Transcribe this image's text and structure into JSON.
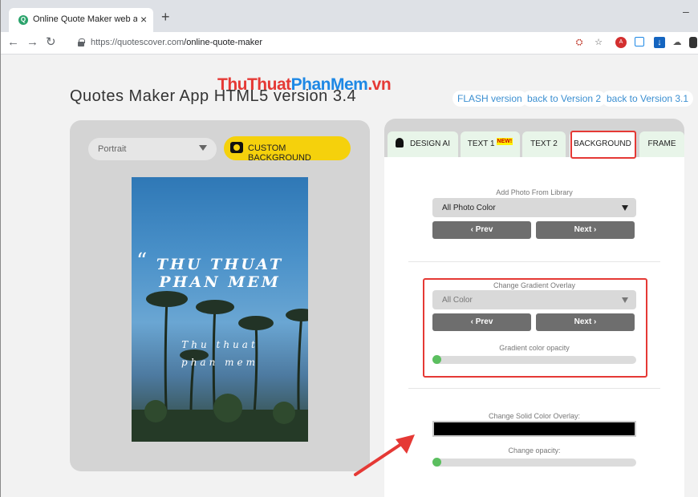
{
  "browser": {
    "tab_title": "Online Quote Maker web applica",
    "tab_favicon": "Q",
    "url_host": "https://quotescover.com",
    "url_path": "/online-quote-maker"
  },
  "page": {
    "title": "Quotes Maker App HTML5 version 3.4",
    "version_links": [
      "FLASH version",
      "back to Version 2",
      "back to Version 3.1"
    ],
    "orientation_select": "Portrait",
    "custom_background_label": "CUSTOM BACKGROUND",
    "watermark_part1": "ThuThuat",
    "watermark_part2": "PhanMem",
    "watermark_part3": ".vn",
    "quote_main_line1": "THU THUAT",
    "quote_main_line2": "PHAN MEM",
    "quote_author_line1": "Thu thuat",
    "quote_author_line2": "phan mem"
  },
  "tabs": {
    "design_ai": "DESIGN AI",
    "text1": "TEXT 1",
    "text1_badge": "NEW!",
    "text2": "TEXT 2",
    "background": "BACKGROUND",
    "frame": "FRAME"
  },
  "library": {
    "label": "Add Photo From Library",
    "select_value": "All Photo Color",
    "prev": "‹ Prev",
    "next": "Next ›"
  },
  "gradient": {
    "label": "Change Gradient Overlay",
    "select_value": "All Color",
    "prev": "‹ Prev",
    "next": "Next ›",
    "opacity_label": "Gradient color opacity",
    "opacity_value": 0
  },
  "solid": {
    "label": "Change Solid Color Overlay:",
    "color": "#000000",
    "opacity_label": "Change opacity:",
    "opacity_value": 0
  },
  "colors": {
    "accent_green": "#5bbf5f",
    "highlight_red": "#e53935",
    "custom_bg_yellow": "#f5d10c",
    "link_blue": "#3b8fd1"
  }
}
